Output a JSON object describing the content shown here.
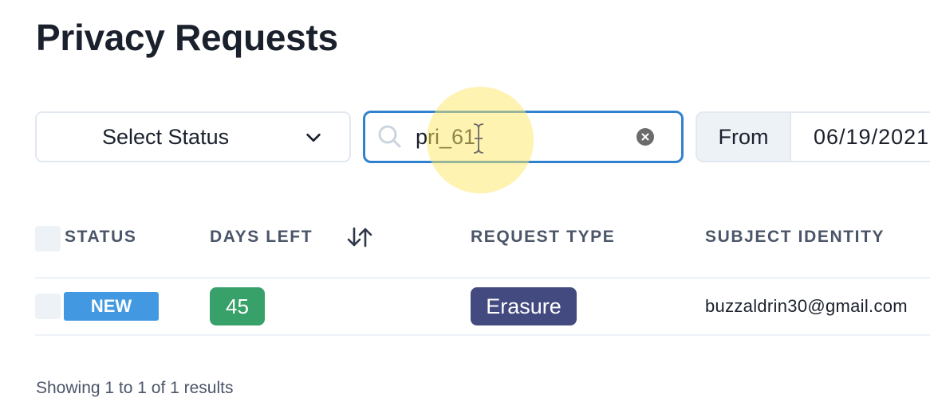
{
  "page": {
    "title": "Privacy Requests"
  },
  "filters": {
    "status_select": {
      "label": "Select Status",
      "icon": "chevron-down-icon"
    },
    "search": {
      "value": "pri_61",
      "placeholder": "",
      "search_icon": "search-icon",
      "clear_icon": "close-circle-icon"
    },
    "date_from": {
      "addon_label": "From",
      "value": "06/19/2021"
    }
  },
  "table": {
    "columns": [
      {
        "key": "status",
        "label": "STATUS"
      },
      {
        "key": "days_left",
        "label": "DAYS LEFT",
        "sortable": true,
        "sort_icon": "sort-arrows-icon"
      },
      {
        "key": "request_type",
        "label": "REQUEST TYPE"
      },
      {
        "key": "subject_identity",
        "label": "SUBJECT IDENTITY"
      }
    ],
    "rows": [
      {
        "status": "NEW",
        "days_left": "45",
        "request_type": "Erasure",
        "subject_identity": "buzzaldrin30@gmail.com"
      }
    ]
  },
  "pagination": {
    "summary": "Showing 1 to 1 of 1 results"
  },
  "colors": {
    "status_new": "#4299e1",
    "days_left_ok": "#38a169",
    "request_type_erasure": "#434a80",
    "focus_border": "#3182ce"
  }
}
